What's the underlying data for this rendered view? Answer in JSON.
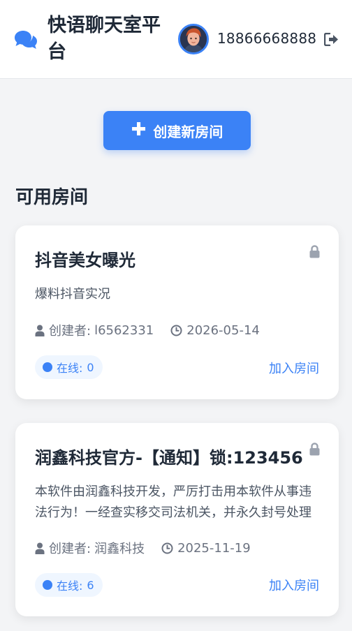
{
  "header": {
    "app_title": "快语聊天室平台",
    "phone": "18866668888"
  },
  "actions": {
    "create_room_label": "创建新房间"
  },
  "section": {
    "title": "可用房间"
  },
  "rooms": [
    {
      "name": "抖音美女曝光",
      "description": "爆料抖音实况",
      "creator_label": "创建者:",
      "creator": "l6562331",
      "date": "2026-05-14",
      "online_label": "在线:",
      "online_count": "0",
      "join_label": "加入房间",
      "locked": true
    },
    {
      "name": "润鑫科技官方-【通知】锁:123456",
      "description": "本软件由润鑫科技开发，严厉打击用本软件从事违法行为！一经查实移交司法机关，并永久封号处理",
      "creator_label": "创建者:",
      "creator": "润鑫科技",
      "date": "2025-11-19",
      "online_label": "在线:",
      "online_count": "6",
      "join_label": "加入房间",
      "locked": true
    }
  ],
  "colors": {
    "accent": "#3b82f6",
    "background": "#f3f4f6",
    "icon_gray": "#9ca3af"
  },
  "icons": {
    "logo": "comments-icon",
    "logout": "sign-out-icon",
    "lock": "lock-icon",
    "creator": "user-icon",
    "date": "clock-icon",
    "create": "plus-icon"
  }
}
